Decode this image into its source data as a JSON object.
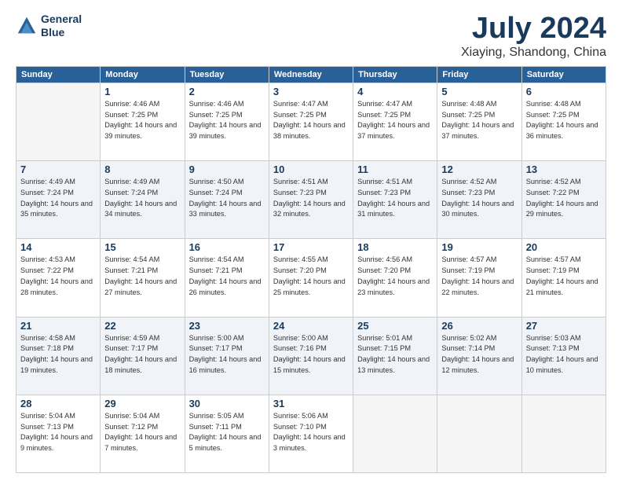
{
  "header": {
    "logo_line1": "General",
    "logo_line2": "Blue",
    "month": "July 2024",
    "location": "Xiaying, Shandong, China"
  },
  "weekdays": [
    "Sunday",
    "Monday",
    "Tuesday",
    "Wednesday",
    "Thursday",
    "Friday",
    "Saturday"
  ],
  "weeks": [
    [
      {
        "day": "",
        "empty": true
      },
      {
        "day": "1",
        "sunrise": "4:46 AM",
        "sunset": "7:25 PM",
        "daylight": "14 hours and 39 minutes."
      },
      {
        "day": "2",
        "sunrise": "4:46 AM",
        "sunset": "7:25 PM",
        "daylight": "14 hours and 39 minutes."
      },
      {
        "day": "3",
        "sunrise": "4:47 AM",
        "sunset": "7:25 PM",
        "daylight": "14 hours and 38 minutes."
      },
      {
        "day": "4",
        "sunrise": "4:47 AM",
        "sunset": "7:25 PM",
        "daylight": "14 hours and 37 minutes."
      },
      {
        "day": "5",
        "sunrise": "4:48 AM",
        "sunset": "7:25 PM",
        "daylight": "14 hours and 37 minutes."
      },
      {
        "day": "6",
        "sunrise": "4:48 AM",
        "sunset": "7:25 PM",
        "daylight": "14 hours and 36 minutes."
      }
    ],
    [
      {
        "day": "7",
        "sunrise": "4:49 AM",
        "sunset": "7:24 PM",
        "daylight": "14 hours and 35 minutes."
      },
      {
        "day": "8",
        "sunrise": "4:49 AM",
        "sunset": "7:24 PM",
        "daylight": "14 hours and 34 minutes."
      },
      {
        "day": "9",
        "sunrise": "4:50 AM",
        "sunset": "7:24 PM",
        "daylight": "14 hours and 33 minutes."
      },
      {
        "day": "10",
        "sunrise": "4:51 AM",
        "sunset": "7:23 PM",
        "daylight": "14 hours and 32 minutes."
      },
      {
        "day": "11",
        "sunrise": "4:51 AM",
        "sunset": "7:23 PM",
        "daylight": "14 hours and 31 minutes."
      },
      {
        "day": "12",
        "sunrise": "4:52 AM",
        "sunset": "7:23 PM",
        "daylight": "14 hours and 30 minutes."
      },
      {
        "day": "13",
        "sunrise": "4:52 AM",
        "sunset": "7:22 PM",
        "daylight": "14 hours and 29 minutes."
      }
    ],
    [
      {
        "day": "14",
        "sunrise": "4:53 AM",
        "sunset": "7:22 PM",
        "daylight": "14 hours and 28 minutes."
      },
      {
        "day": "15",
        "sunrise": "4:54 AM",
        "sunset": "7:21 PM",
        "daylight": "14 hours and 27 minutes."
      },
      {
        "day": "16",
        "sunrise": "4:54 AM",
        "sunset": "7:21 PM",
        "daylight": "14 hours and 26 minutes."
      },
      {
        "day": "17",
        "sunrise": "4:55 AM",
        "sunset": "7:20 PM",
        "daylight": "14 hours and 25 minutes."
      },
      {
        "day": "18",
        "sunrise": "4:56 AM",
        "sunset": "7:20 PM",
        "daylight": "14 hours and 23 minutes."
      },
      {
        "day": "19",
        "sunrise": "4:57 AM",
        "sunset": "7:19 PM",
        "daylight": "14 hours and 22 minutes."
      },
      {
        "day": "20",
        "sunrise": "4:57 AM",
        "sunset": "7:19 PM",
        "daylight": "14 hours and 21 minutes."
      }
    ],
    [
      {
        "day": "21",
        "sunrise": "4:58 AM",
        "sunset": "7:18 PM",
        "daylight": "14 hours and 19 minutes."
      },
      {
        "day": "22",
        "sunrise": "4:59 AM",
        "sunset": "7:17 PM",
        "daylight": "14 hours and 18 minutes."
      },
      {
        "day": "23",
        "sunrise": "5:00 AM",
        "sunset": "7:17 PM",
        "daylight": "14 hours and 16 minutes."
      },
      {
        "day": "24",
        "sunrise": "5:00 AM",
        "sunset": "7:16 PM",
        "daylight": "14 hours and 15 minutes."
      },
      {
        "day": "25",
        "sunrise": "5:01 AM",
        "sunset": "7:15 PM",
        "daylight": "14 hours and 13 minutes."
      },
      {
        "day": "26",
        "sunrise": "5:02 AM",
        "sunset": "7:14 PM",
        "daylight": "14 hours and 12 minutes."
      },
      {
        "day": "27",
        "sunrise": "5:03 AM",
        "sunset": "7:13 PM",
        "daylight": "14 hours and 10 minutes."
      }
    ],
    [
      {
        "day": "28",
        "sunrise": "5:04 AM",
        "sunset": "7:13 PM",
        "daylight": "14 hours and 9 minutes."
      },
      {
        "day": "29",
        "sunrise": "5:04 AM",
        "sunset": "7:12 PM",
        "daylight": "14 hours and 7 minutes."
      },
      {
        "day": "30",
        "sunrise": "5:05 AM",
        "sunset": "7:11 PM",
        "daylight": "14 hours and 5 minutes."
      },
      {
        "day": "31",
        "sunrise": "5:06 AM",
        "sunset": "7:10 PM",
        "daylight": "14 hours and 3 minutes."
      },
      {
        "day": "",
        "empty": true
      },
      {
        "day": "",
        "empty": true
      },
      {
        "day": "",
        "empty": true
      }
    ]
  ]
}
